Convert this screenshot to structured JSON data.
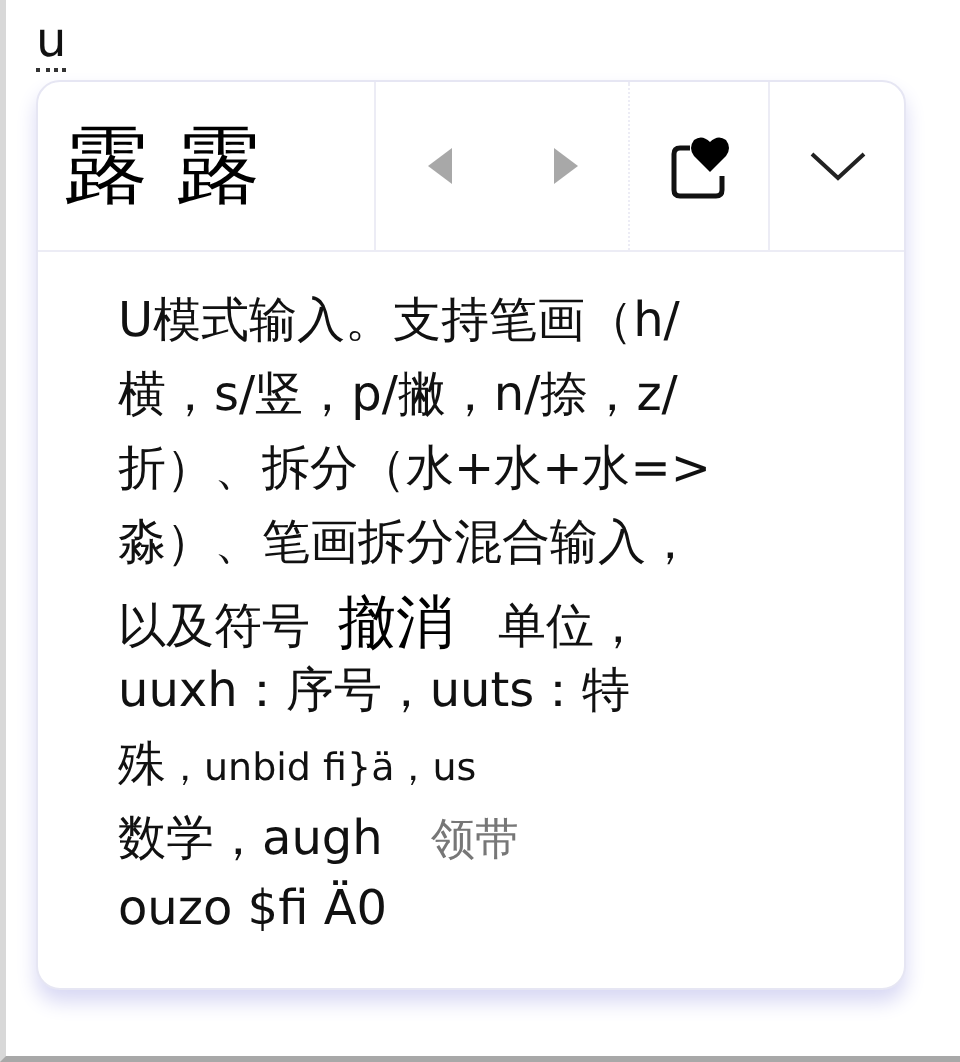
{
  "composition": "u",
  "candidates": [
    {
      "text": "露"
    },
    {
      "text": "露"
    }
  ],
  "nav": {
    "prev_disabled": true,
    "next_disabled": true
  },
  "description": [
    [
      {
        "kind": "normal",
        "text": "U模式输入。支持笔画（h/"
      }
    ],
    [
      {
        "kind": "normal",
        "text": "横，s/竖，p/撇，n/捺，z/"
      }
    ],
    [
      {
        "kind": "normal",
        "text": "折）、拆分（水+水+水=>"
      }
    ],
    [
      {
        "kind": "normal",
        "text": "淼）、笔画拆分混合输入，"
      }
    ],
    [
      {
        "kind": "normal",
        "text": "以及符号"
      },
      {
        "kind": "large",
        "text": "撤消"
      },
      {
        "kind": "normal",
        "text": "单位，"
      }
    ],
    [
      {
        "kind": "normal",
        "text": "uuxh：序号，uuts：特"
      }
    ],
    [
      {
        "kind": "normal",
        "text": "殊"
      },
      {
        "kind": "small",
        "text": "，unbid fi}ä，us"
      }
    ],
    [
      {
        "kind": "normal",
        "text": "数学，augh"
      },
      {
        "kind": "dim",
        "text": "领带"
      }
    ],
    [
      {
        "kind": "normal",
        "text": "ouzo $fi Ä0"
      }
    ]
  ]
}
